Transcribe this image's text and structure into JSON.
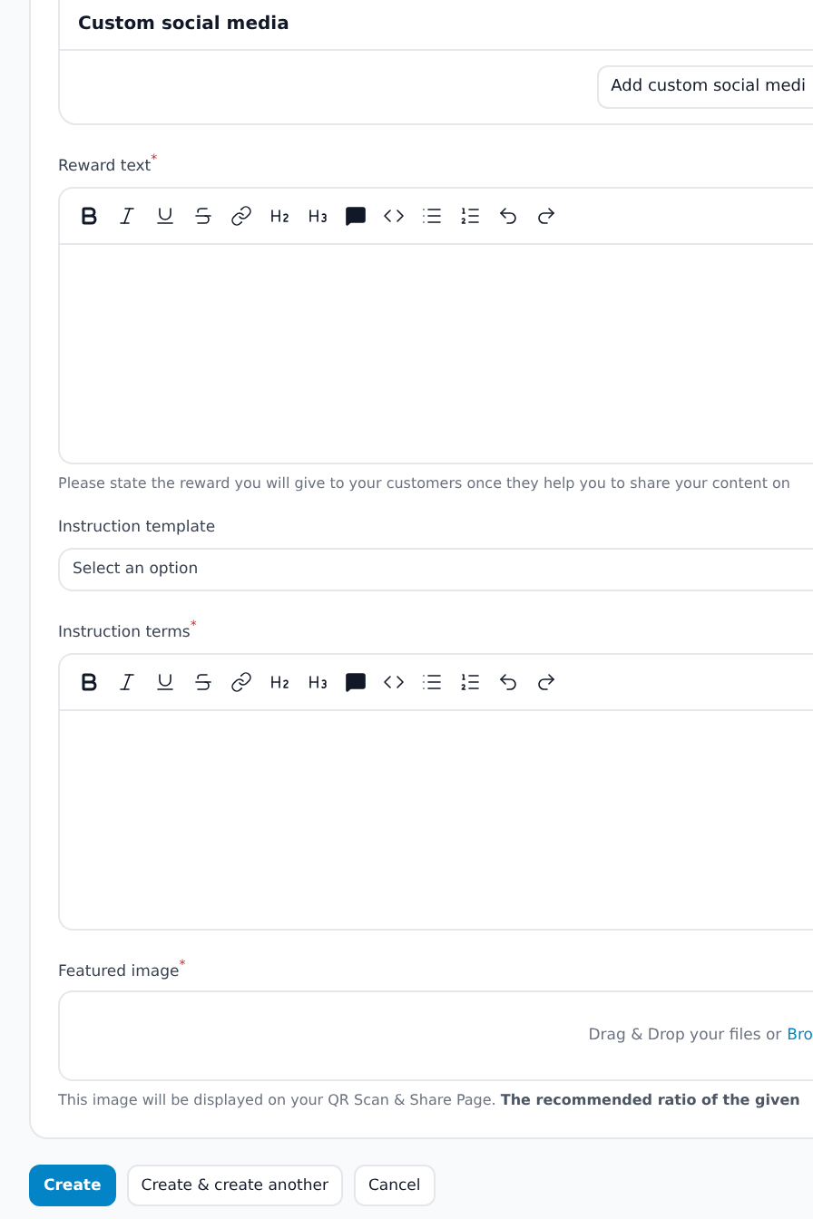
{
  "custom_social_media": {
    "title": "Custom social media",
    "add_button": "Add custom social medi"
  },
  "fields": [
    {
      "kind": "editor",
      "label": "Reward text",
      "required_mark": "*",
      "helper": "Please state the reward you will give to your customers once they help you to share your content on"
    },
    {
      "kind": "select",
      "label": "Instruction template",
      "placeholder": "Select an option"
    },
    {
      "kind": "editor",
      "label": "Instruction terms",
      "required_mark": "*"
    },
    {
      "kind": "upload",
      "label": "Featured image",
      "required_mark": "*",
      "drop_text": "Drag & Drop your files or",
      "browse_link": "Bro",
      "helper": "This image will be displayed on your QR Scan & Share Page. **The recommended ratio of the given**"
    }
  ],
  "actions": [
    {
      "label": "Create",
      "primary": true
    },
    {
      "label": "Create & create another",
      "primary": false
    },
    {
      "label": "Cancel",
      "primary": false
    }
  ]
}
